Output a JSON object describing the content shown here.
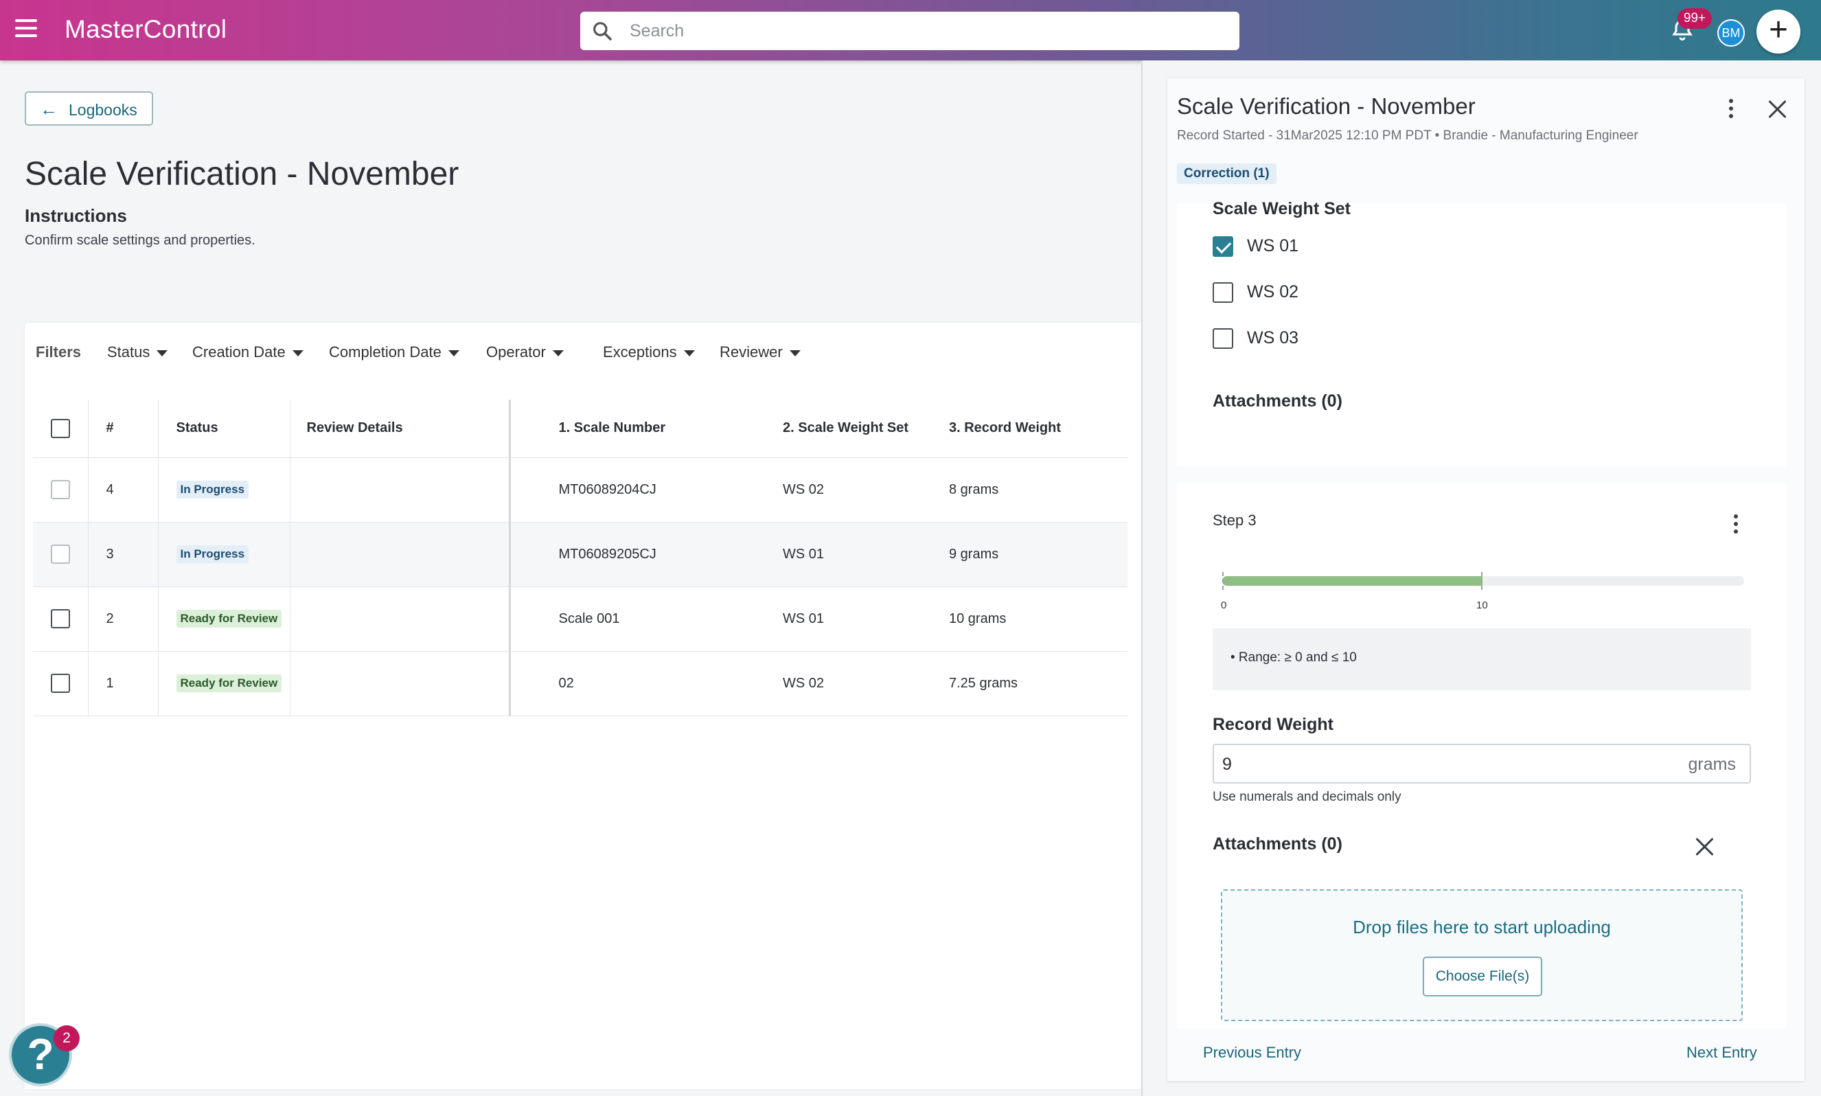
{
  "header": {
    "brand": "MasterControl",
    "search_placeholder": "Search",
    "notifications_count": "99+",
    "avatar_initials": "BM"
  },
  "main": {
    "back_label": "Logbooks",
    "title": "Scale Verification - November",
    "instructions_heading": "Instructions",
    "instructions_text": "Confirm scale settings and properties.",
    "filters_label": "Filters",
    "filters": [
      "Status",
      "Creation Date",
      "Completion Date",
      "Operator",
      "Exceptions",
      "Reviewer"
    ],
    "columns": [
      "#",
      "Status",
      "Review Details",
      "1. Scale Number",
      "2. Scale Weight Set",
      "3. Record Weight"
    ],
    "rows": [
      {
        "num": "4",
        "status": "In Progress",
        "review": "",
        "scale": "MT06089204CJ",
        "wset": "WS 02",
        "weight": "8 grams"
      },
      {
        "num": "3",
        "status": "In Progress",
        "review": "",
        "scale": "MT06089205CJ",
        "wset": "WS 01",
        "weight": "9 grams"
      },
      {
        "num": "2",
        "status": "Ready for Review",
        "review": "",
        "scale": "Scale 001",
        "wset": "WS 01",
        "weight": "10 grams"
      },
      {
        "num": "1",
        "status": "Ready for Review",
        "review": "",
        "scale": "02",
        "wset": "WS 02",
        "weight": "7.25 grams"
      }
    ],
    "help_badge": "2"
  },
  "panel": {
    "title": "Scale Verification - November",
    "subtitle": "Record Started - 31Mar2025 12:10 PM PDT • Brandie - Manufacturing Engineer",
    "correction_badge": "Correction (1)",
    "weight_set_heading": "Scale Weight Set",
    "weight_set_options": [
      {
        "label": "WS 01",
        "checked": true
      },
      {
        "label": "WS 02",
        "checked": false
      },
      {
        "label": "WS 03",
        "checked": false
      }
    ],
    "attachments_1": "Attachments (0)",
    "step_label": "Step 3",
    "range_min_label": "0",
    "range_max_label": "10",
    "range_fill_fraction": 0.5,
    "range_text": "• Range: ≥ 0 and ≤ 10",
    "record_weight_label": "Record Weight",
    "record_weight_value": "9",
    "record_weight_unit": "grams",
    "record_weight_help": "Use numerals and decimals only",
    "attachments_2": "Attachments (0)",
    "drop_text": "Drop files here to start uploading",
    "choose_label": "Choose File(s)",
    "prev_label": "Previous Entry",
    "next_label": "Next Entry"
  }
}
